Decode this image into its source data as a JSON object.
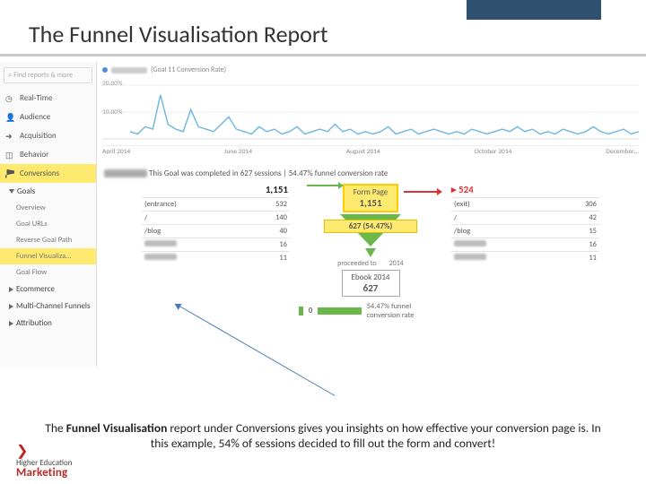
{
  "slide": {
    "title": "The Funnel Visualisation Report",
    "caption_parts": {
      "pre": "The ",
      "bold": "Funnel Visualisation",
      "post": " report under Conversions gives you insights on how effective your conversion page is. In this example, 54% of sessions decided to fill out the form and convert!"
    },
    "brand_line1": "Higher Education",
    "brand_line2": "Marketing"
  },
  "sidebar": {
    "search_placeholder": "Find reports & more",
    "items": [
      {
        "label": "Real-Time"
      },
      {
        "label": "Audience"
      },
      {
        "label": "Acquisition"
      },
      {
        "label": "Behavior"
      },
      {
        "label": "Conversions",
        "selected": true
      }
    ],
    "goals_group": "Goals",
    "subs": [
      {
        "label": "Overview"
      },
      {
        "label": "Goal URLs"
      },
      {
        "label": "Reverse Goal Path"
      },
      {
        "label": "Funnel Visualiza…",
        "selected": true
      },
      {
        "label": "Goal Flow"
      }
    ],
    "groups": [
      {
        "label": "Ecommerce"
      },
      {
        "label": "Multi-Channel Funnels"
      },
      {
        "label": "Attribution"
      }
    ]
  },
  "chart_data": {
    "type": "line",
    "title": "",
    "legend": "(Goal 11 Conversion Rate)",
    "ylabel": "",
    "yticks": [
      "20.00%",
      "10.00%"
    ],
    "xticks": [
      "April 2014",
      "June 2014",
      "August 2014",
      "October 2014",
      "December…"
    ],
    "ylim": [
      0,
      22
    ],
    "series": [
      {
        "name": "Goal 11 Conversion Rate",
        "color": "#6fb6e0",
        "values": [
          3,
          2,
          5,
          4,
          18,
          6,
          4,
          3,
          12,
          5,
          4,
          3,
          6,
          9,
          4,
          3,
          2,
          5,
          3,
          4,
          2,
          3,
          5,
          2,
          3,
          4,
          3,
          6,
          3,
          4,
          2,
          3,
          2,
          3,
          5,
          2,
          3,
          4,
          2,
          3,
          4,
          3,
          2,
          3,
          2,
          4,
          3,
          2,
          3,
          4,
          3,
          5,
          3,
          4,
          2,
          3,
          2,
          4,
          3,
          2,
          3,
          5,
          3,
          2,
          3,
          4,
          2,
          3
        ]
      }
    ]
  },
  "report": {
    "completed_text": "This Goal was completed in 627 sessions | 54.47% funnel conversion rate",
    "step1": {
      "title": "Form Page",
      "value": "1,151"
    },
    "entries_total": "1,151",
    "exits_total": "524",
    "left_rows": [
      {
        "label": "(entrance)",
        "val": "532"
      },
      {
        "label": "/",
        "val": "140"
      },
      {
        "label": "/blog",
        "val": "40"
      },
      {
        "label": "",
        "val": "16"
      },
      {
        "label": "",
        "val": "11"
      }
    ],
    "right_rows": [
      {
        "label": "(exit)",
        "val": "306"
      },
      {
        "label": "/",
        "val": "42"
      },
      {
        "label": "/blog",
        "val": "15"
      },
      {
        "label": "",
        "val": "16"
      },
      {
        "label": "",
        "val": "11"
      }
    ],
    "funnel_pass": "627 (54.47%)",
    "proceeded_label": "proceeded to",
    "proceeded_target": "2014",
    "step2": {
      "title": "Ebook 2014",
      "value": "627"
    },
    "end_value": "0",
    "end_text": "54.47% funnel conversion rate"
  }
}
